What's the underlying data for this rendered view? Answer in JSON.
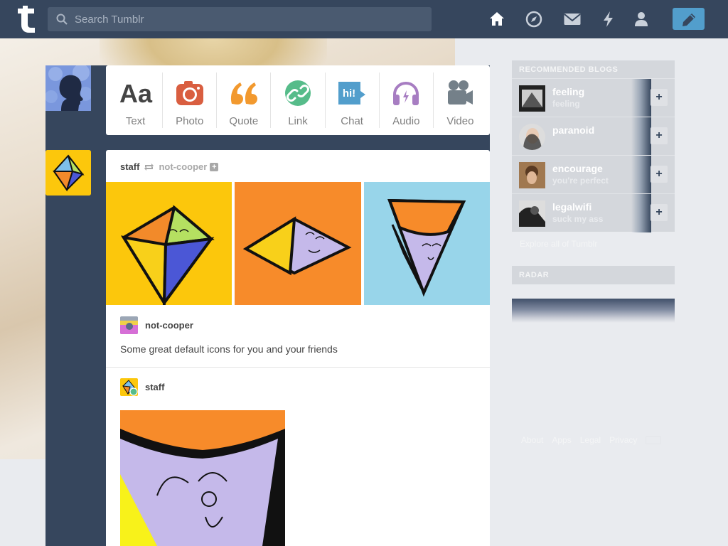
{
  "header": {
    "search_placeholder": "Search Tumblr",
    "nav_icons": [
      "home-icon",
      "explore-icon",
      "messages-icon",
      "activity-icon",
      "account-icon"
    ],
    "compose_icon": "pencil-icon"
  },
  "post_types": [
    {
      "label": "Text",
      "icon": "text-icon",
      "color": "#444444"
    },
    {
      "label": "Photo",
      "icon": "camera-icon",
      "color": "#d95e40"
    },
    {
      "label": "Quote",
      "icon": "quote-icon",
      "color": "#f2992e"
    },
    {
      "label": "Link",
      "icon": "link-icon",
      "color": "#56bc8a"
    },
    {
      "label": "Chat",
      "icon": "chat-icon",
      "color": "#529ecc"
    },
    {
      "label": "Audio",
      "icon": "headphones-icon",
      "color": "#a77dc2"
    },
    {
      "label": "Video",
      "icon": "video-camera-icon",
      "color": "#748089"
    }
  ],
  "post": {
    "author": "staff",
    "reblogged_from": "not-cooper",
    "reblog_user": "not-cooper",
    "caption": "Some great default icons for you and your friends",
    "second_user": "staff"
  },
  "sidebar": {
    "recommended_heading": "RECOMMENDED BLOGS",
    "blogs": [
      {
        "name": "feeling",
        "title": "feeling"
      },
      {
        "name": "paranoid",
        "title": ""
      },
      {
        "name": "encourage",
        "title": "you're perfect"
      },
      {
        "name": "legalwifi",
        "title": "suck my ass"
      }
    ],
    "explore_link": "Explore all of Tumblr",
    "radar_heading": "RADAR",
    "footer": [
      "About",
      "Apps",
      "Legal",
      "Privacy"
    ]
  },
  "colors": {
    "navy": "#36465d",
    "accent_blue": "#529ecc"
  }
}
